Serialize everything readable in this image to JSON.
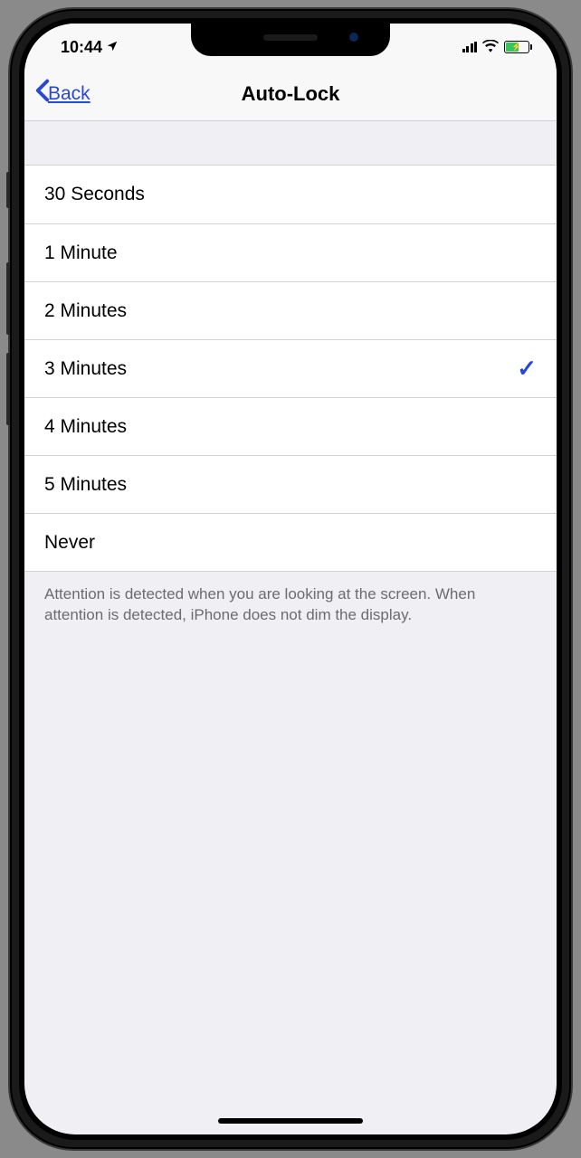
{
  "status_bar": {
    "time": "10:44"
  },
  "nav": {
    "back_label": "Back",
    "title": "Auto-Lock"
  },
  "options": [
    {
      "label": "30 Seconds",
      "selected": false
    },
    {
      "label": "1 Minute",
      "selected": false
    },
    {
      "label": "2 Minutes",
      "selected": false
    },
    {
      "label": "3 Minutes",
      "selected": true
    },
    {
      "label": "4 Minutes",
      "selected": false
    },
    {
      "label": "5 Minutes",
      "selected": false
    },
    {
      "label": "Never",
      "selected": false
    }
  ],
  "footer": "Attention is detected when you are looking at the screen. When attention is detected, iPhone does not dim the display."
}
